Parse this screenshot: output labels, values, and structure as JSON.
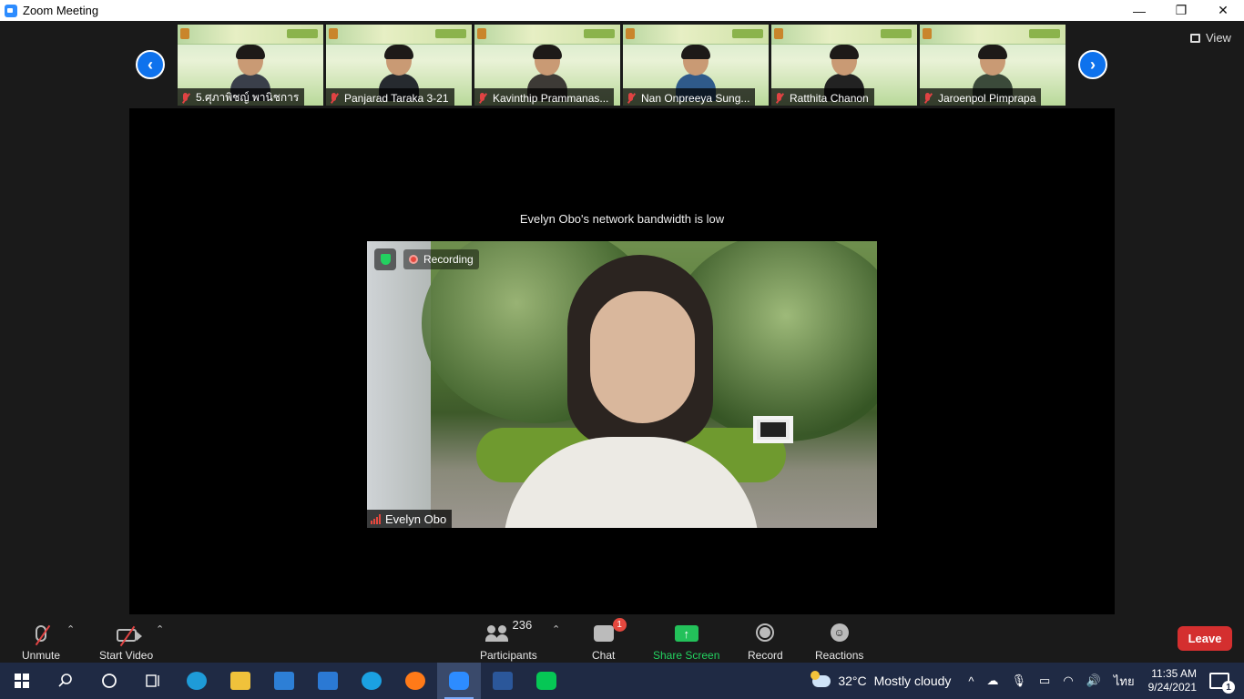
{
  "window": {
    "title": "Zoom Meeting",
    "minimize_glyph": "—",
    "restore_glyph": "❐",
    "close_glyph": "✕"
  },
  "gallery": {
    "prev_glyph": "‹",
    "next_glyph": "›",
    "view_label": "View",
    "thumbnails": [
      {
        "name": "5.ศุภาพิชญ์ พานิชการ",
        "muted": true
      },
      {
        "name": "Panjarad Taraka 3-21",
        "muted": true
      },
      {
        "name": "Kavinthip Prammanas...",
        "muted": true
      },
      {
        "name": "Nan Onpreeya Sung...",
        "muted": true
      },
      {
        "name": "Ratthita Chanon",
        "muted": true
      },
      {
        "name": "Jaroenpol Pimprapa",
        "muted": true
      }
    ]
  },
  "stage": {
    "notice": "Evelyn Obo's network bandwidth is low",
    "recording_label": "Recording",
    "speaker_name": "Evelyn Obo"
  },
  "toolbar": {
    "unmute_label": "Unmute",
    "start_video_label": "Start Video",
    "participants_label": "Participants",
    "participants_count": "236",
    "chat_label": "Chat",
    "chat_badge": "1",
    "share_label": "Share Screen",
    "share_glyph": "↑",
    "record_label": "Record",
    "reactions_label": "Reactions",
    "reactions_glyph": "☺",
    "caret_glyph": "⌃",
    "leave_label": "Leave"
  },
  "taskbar": {
    "weather_temp": "32°C",
    "weather_text": "Mostly cloudy",
    "tray_caret": "^",
    "language": "ไทย",
    "time": "11:35 AM",
    "date": "9/24/2021",
    "notification_count": "1",
    "accent_colors": {
      "edge": "#1e9bd8",
      "explorer": "#f0c23b",
      "store": "#2d7fd6",
      "mail": "#2b79d4",
      "ie": "#1ba1e2",
      "firefox": "#ff7a18",
      "zoom": "#2d8cff",
      "word": "#2b579a",
      "line": "#06c755"
    }
  }
}
